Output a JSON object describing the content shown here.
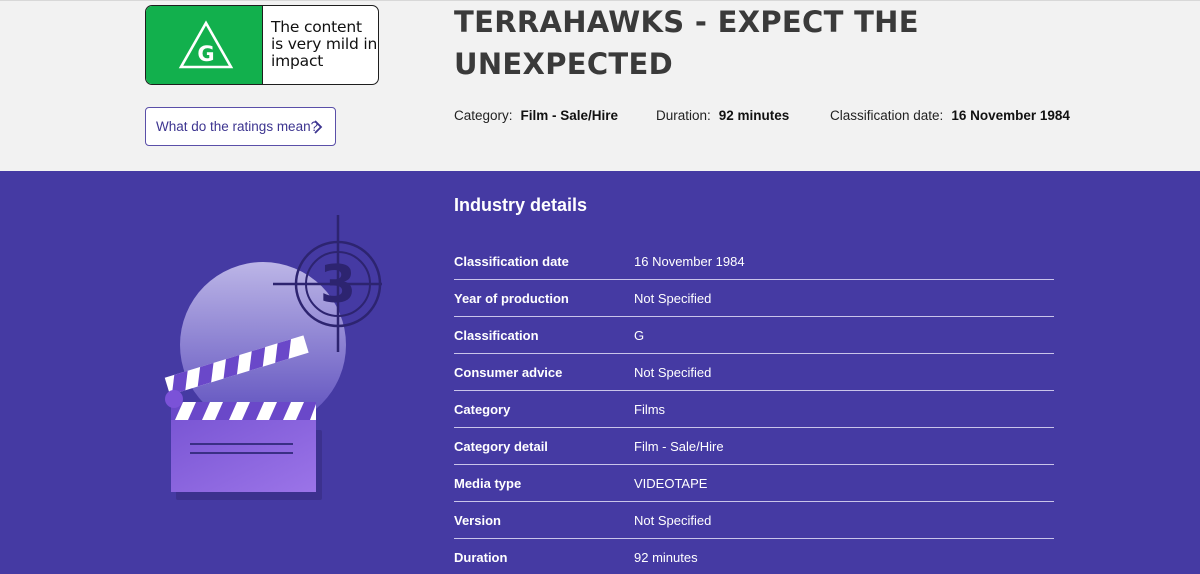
{
  "rating": {
    "letter": "G",
    "description": "The content is very mild in impact",
    "color": "#12b04d"
  },
  "ratings_link": {
    "label": "What do the ratings mean?"
  },
  "title": "TERRAHAWKS - EXPECT THE UNEXPECTED",
  "meta": [
    {
      "label": "Category:",
      "value": "Film - Sale/Hire"
    },
    {
      "label": "Duration:",
      "value": "92 minutes"
    },
    {
      "label": "Classification date:",
      "value": "16 November 1984"
    }
  ],
  "industry": {
    "heading": "Industry details",
    "countdown_number": "3",
    "rows": [
      {
        "label": "Classification date",
        "value": "16 November 1984"
      },
      {
        "label": "Year of production",
        "value": "Not Specified"
      },
      {
        "label": "Classification",
        "value": "G"
      },
      {
        "label": "Consumer advice",
        "value": "Not Specified"
      },
      {
        "label": "Category",
        "value": "Films"
      },
      {
        "label": "Category detail",
        "value": "Film - Sale/Hire"
      },
      {
        "label": "Media type",
        "value": "VIDEOTAPE"
      },
      {
        "label": "Version",
        "value": "Not Specified"
      },
      {
        "label": "Duration",
        "value": "92 minutes"
      }
    ]
  },
  "colors": {
    "purple_bg": "#453aa3",
    "light_bg": "#f2f2f2",
    "link_border": "#5a4fa8"
  }
}
